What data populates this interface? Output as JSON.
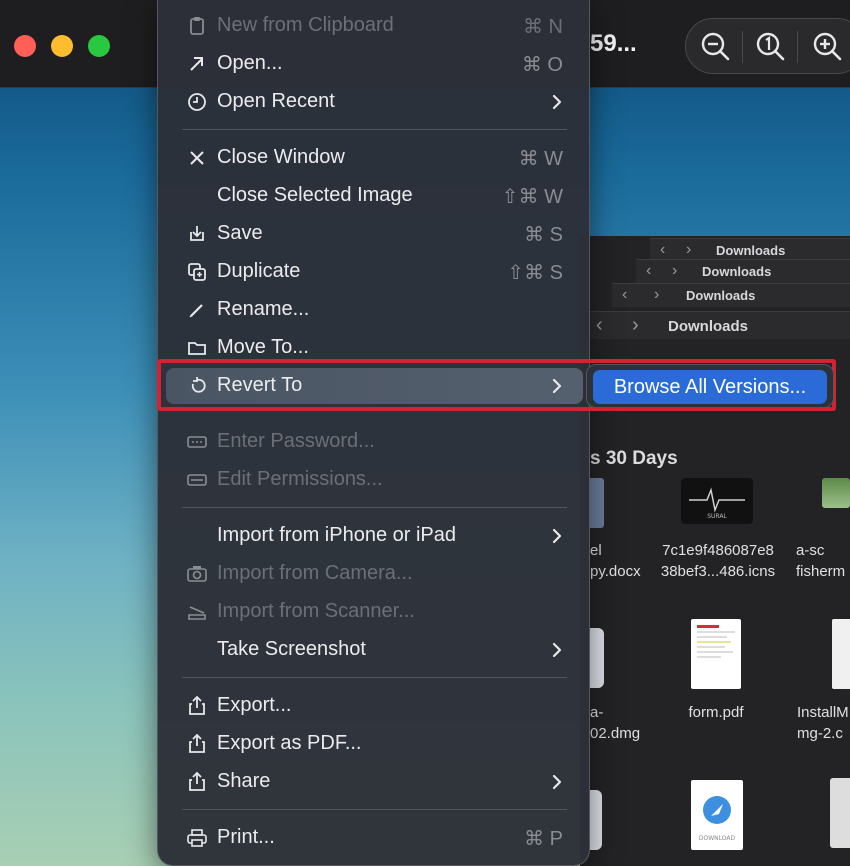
{
  "window": {
    "title_fragment": "59...",
    "zoom": {
      "zoom_out_icon": "zoom-out-icon",
      "actual_size_icon": "actual-size-icon",
      "zoom_in_icon": "zoom-in-icon"
    }
  },
  "menu": {
    "items": [
      {
        "label": "New from Clipboard",
        "shortcut": "⌘ N",
        "icon": "clipboard-icon",
        "enabled": false
      },
      {
        "label": "Open...",
        "shortcut": "⌘ O",
        "icon": "open-arrow-icon",
        "enabled": true
      },
      {
        "label": "Open Recent",
        "shortcut": "",
        "icon": "clock-icon",
        "enabled": true,
        "submenu": true
      },
      {
        "label": "Close Window",
        "shortcut": "⌘ W",
        "icon": "close-icon",
        "enabled": true
      },
      {
        "label": "Close Selected Image",
        "shortcut": "⇧⌘ W",
        "icon": "",
        "enabled": true
      },
      {
        "label": "Save",
        "shortcut": "⌘ S",
        "icon": "save-icon",
        "enabled": true
      },
      {
        "label": "Duplicate",
        "shortcut": "⇧⌘ S",
        "icon": "duplicate-icon",
        "enabled": true
      },
      {
        "label": "Rename...",
        "shortcut": "",
        "icon": "pencil-icon",
        "enabled": true
      },
      {
        "label": "Move To...",
        "shortcut": "",
        "icon": "folder-icon",
        "enabled": true
      },
      {
        "label": "Revert To",
        "shortcut": "",
        "icon": "revert-icon",
        "enabled": true,
        "submenu": true,
        "active": true
      },
      {
        "label": "Enter Password...",
        "shortcut": "",
        "icon": "password-icon",
        "enabled": false
      },
      {
        "label": "Edit Permissions...",
        "shortcut": "",
        "icon": "permissions-icon",
        "enabled": false
      },
      {
        "label": "Import from iPhone or iPad",
        "shortcut": "",
        "icon": "",
        "enabled": true,
        "submenu": true
      },
      {
        "label": "Import from Camera...",
        "shortcut": "",
        "icon": "camera-icon",
        "enabled": false
      },
      {
        "label": "Import from Scanner...",
        "shortcut": "",
        "icon": "scanner-icon",
        "enabled": false
      },
      {
        "label": "Take Screenshot",
        "shortcut": "",
        "icon": "",
        "enabled": true,
        "submenu": true
      },
      {
        "label": "Export...",
        "shortcut": "",
        "icon": "export-icon",
        "enabled": true
      },
      {
        "label": "Export as PDF...",
        "shortcut": "",
        "icon": "export-pdf-icon",
        "enabled": true
      },
      {
        "label": "Share",
        "shortcut": "",
        "icon": "share-icon",
        "enabled": true,
        "submenu": true
      },
      {
        "label": "Print...",
        "shortcut": "⌘ P",
        "icon": "printer-icon",
        "enabled": true
      }
    ]
  },
  "submenu": {
    "browse_all_versions": "Browse All Versions..."
  },
  "finder": {
    "path_bars": [
      "Downloads",
      "Downloads",
      "Downloads",
      "Downloads"
    ],
    "section_title": "s 30 Days",
    "files": [
      {
        "name_line1": "el",
        "name_line2": "py.docx"
      },
      {
        "name_line1": "7c1e9f486087e8",
        "name_line2": "38bef3...486.icns"
      },
      {
        "name_line1": "a-sc",
        "name_line2": "fisherm"
      },
      {
        "name_line1": "a-",
        "name_line2": "02.dmg"
      },
      {
        "name_line1": "form.pdf",
        "name_line2": ""
      },
      {
        "name_line1": "InstallM",
        "name_line2": "mg-2.c"
      }
    ],
    "thumb_caption": "SURAL",
    "download_caption": "DOWNLOAD"
  },
  "colors": {
    "highlight_border": "#d62230",
    "submenu_selected": "#2a6bd8",
    "menu_bg": "#2c3038"
  }
}
